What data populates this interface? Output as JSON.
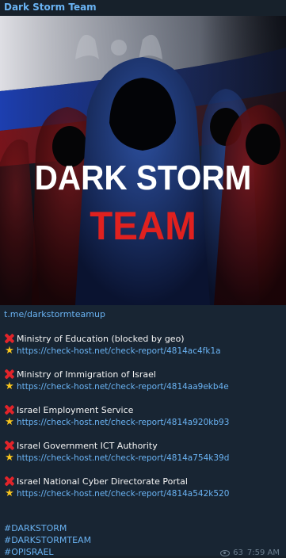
{
  "channel": {
    "name": "Dark Storm Team"
  },
  "banner": {
    "line1": "DARK STORM",
    "line2": "TEAM"
  },
  "post": {
    "source_link": "t.me/darkstormteamup",
    "entries": [
      {
        "title": "Ministry of Education (blocked by geo)",
        "link": "https://check-host.net/check-report/4814ac4fk1a"
      },
      {
        "title": "Ministry of Immigration of Israel",
        "link": "https://check-host.net/check-report/4814aa9ekb4e"
      },
      {
        "title": "Israel Employment Service",
        "link": "https://check-host.net/check-report/4814a920kb93"
      },
      {
        "title": "Israel Government ICT Authority",
        "link": "https://check-host.net/check-report/4814a754k39d"
      },
      {
        "title": "Israel National Cyber Directorate Portal",
        "link": "https://check-host.net/check-report/4814a542k520"
      }
    ],
    "hashtags": [
      "#DARKSTORM",
      "#DARKSTORMTEAM",
      "#OPISRAEL"
    ],
    "views": "63",
    "time": "7:59 AM"
  },
  "icons": {
    "entry_status": "cross-mark-icon",
    "entry_link": "star-icon",
    "views": "eye-icon"
  },
  "colors": {
    "accent": "#6ab3f3",
    "cross": "#e0242a",
    "star": "#f8c51d",
    "banner_red": "#e0211f"
  }
}
